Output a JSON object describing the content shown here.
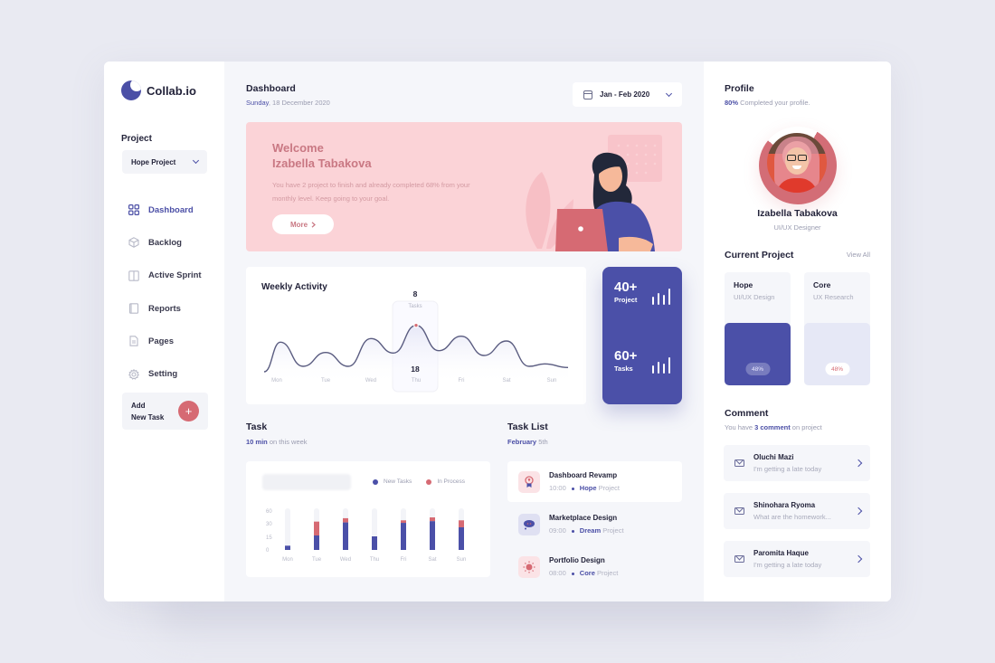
{
  "app": {
    "name": "Collab.io"
  },
  "sidebar": {
    "project_label": "Project",
    "project_select": "Hope Project",
    "items": [
      {
        "label": "Dashboard",
        "icon": "grid-icon",
        "active": true
      },
      {
        "label": "Backlog",
        "icon": "cube-icon",
        "active": false
      },
      {
        "label": "Active Sprint",
        "icon": "columns-icon",
        "active": false
      },
      {
        "label": "Reports",
        "icon": "report-icon",
        "active": false
      },
      {
        "label": "Pages",
        "icon": "document-icon",
        "active": false
      },
      {
        "label": "Setting",
        "icon": "gear-icon",
        "active": false
      }
    ],
    "add_task": {
      "line1": "Add",
      "line2": "New Task",
      "button": "+"
    }
  },
  "header": {
    "title": "Dashboard",
    "day": "Sunday",
    "date": ", 18 December 2020",
    "date_range": "Jan - Feb 2020"
  },
  "welcome": {
    "line1": "Welcome",
    "line2": "Izabella Tabakova",
    "text": "You have 2 project to finish and already completed 68% from your monthly level. Keep going to your goal.",
    "button": "More"
  },
  "weekly_activity": {
    "title": "Weekly Activity",
    "highlight": {
      "value": "8",
      "label": "Tasks",
      "date": "18",
      "day": "Thu"
    }
  },
  "stats": [
    {
      "value": "40+",
      "label": "Project"
    },
    {
      "value": "60+",
      "label": "Tasks"
    }
  ],
  "task": {
    "title": "Task",
    "highlight": "10 min",
    "sub": " on this week"
  },
  "task_list": {
    "title": "Task List",
    "month": "February",
    "day": " 5th",
    "items": [
      {
        "name": "Dashboard Revamp",
        "time": "10:00",
        "project": "Hope",
        "suffix": " Project",
        "icon": "award-icon",
        "bg": "#fbe3e6",
        "color": "#d66a73"
      },
      {
        "name": "Marketplace Design",
        "time": "09:00",
        "project": "Dream",
        "suffix": " Project",
        "icon": "chat-bubble-icon",
        "bg": "#dfe0f2",
        "color": "#4b50a8"
      },
      {
        "name": "Portfolio Design",
        "time": "08:00",
        "project": "Core",
        "suffix": " Project",
        "icon": "sun-icon",
        "bg": "#fbe3e6",
        "color": "#d66a73"
      }
    ]
  },
  "profile": {
    "title": "Profile",
    "completed_pct": "80%",
    "completed_text": " Completed your profile.",
    "name": "Izabella Tabakova",
    "role": "UI/UX Designer"
  },
  "current_project": {
    "title": "Current Project",
    "view_all": "View All",
    "items": [
      {
        "name": "Hope",
        "type": "UI/UX Design",
        "progress": "48%"
      },
      {
        "name": "Core",
        "type": "UX Research",
        "progress": "48%"
      }
    ]
  },
  "comment": {
    "title": "Comment",
    "prefix": "You have ",
    "count": "3 comment",
    "suffix": " on project",
    "items": [
      {
        "name": "Oluchi Mazi",
        "message": "I'm getting a late today"
      },
      {
        "name": "Shinohara Ryoma",
        "message": "What are the homework..."
      },
      {
        "name": "Paromita Haque",
        "message": "I'm getting a late today"
      }
    ]
  },
  "colors": {
    "primary": "#4b50a8",
    "accent": "#d66a73",
    "welcome_bg": "#fbd3d7"
  },
  "chart_data": [
    {
      "type": "area",
      "title": "Weekly Activity",
      "categories": [
        "Mon",
        "Tue",
        "Wed",
        "Thu",
        "Fri",
        "Sat",
        "Sun"
      ],
      "values": [
        5.2,
        3.5,
        5.8,
        8,
        6.2,
        5.4,
        1.6
      ],
      "grid": false,
      "highlight_index": 3
    },
    {
      "type": "bar",
      "title": "Task",
      "stacked": true,
      "categories": [
        "Mon",
        "Tue",
        "Wed",
        "Thu",
        "Fri",
        "Sat",
        "Sun"
      ],
      "yticks": [
        "0",
        "15",
        "30",
        "60"
      ],
      "ylim": [
        0,
        60
      ],
      "series": [
        {
          "name": "New Tasks",
          "color": "#4b50a8",
          "values": [
            5,
            17,
            33,
            16,
            32,
            36,
            26
          ]
        },
        {
          "name": "In Process",
          "color": "#d66a73",
          "values": [
            0,
            18,
            10,
            0,
            6,
            9,
            12
          ]
        }
      ],
      "legend": "top-right"
    }
  ]
}
